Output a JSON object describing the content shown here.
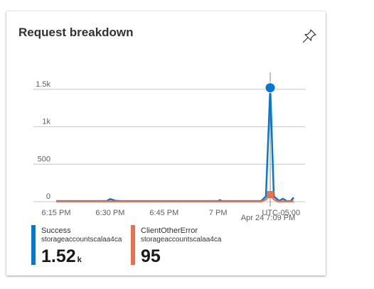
{
  "tile": {
    "title": "Request breakdown",
    "pin_icon": "pin-icon"
  },
  "chart_data": {
    "type": "line",
    "title": "Request breakdown",
    "ylim": [
      0,
      1750
    ],
    "y_ticks": [
      {
        "value": 0,
        "label": "0"
      },
      {
        "value": 500,
        "label": "500"
      },
      {
        "value": 1000,
        "label": "1k"
      },
      {
        "value": 1500,
        "label": "1.5k"
      }
    ],
    "x_ticks": [
      "6:15 PM",
      "6:30 PM",
      "6:45 PM",
      "7 PM",
      "UTC-05:00"
    ],
    "x_range_minutes": [
      0,
      66
    ],
    "x_tick_minutes": [
      0,
      15,
      30,
      45,
      62.5
    ],
    "hover": {
      "x_minute": 59.5,
      "label": "Apr 24 7:09 PM"
    },
    "grid": true,
    "legend_position": "bottom",
    "series": [
      {
        "name": "Success",
        "color": "#0078d4",
        "x": [
          0,
          14,
          15,
          16.5,
          18,
          45,
          45.5,
          46,
          57,
          58.3,
          59.5,
          60.5,
          62,
          63,
          64,
          65.2,
          66
        ],
        "y": [
          8,
          8,
          35,
          12,
          8,
          8,
          22,
          8,
          10,
          70,
          1520,
          70,
          10,
          40,
          10,
          8,
          55
        ],
        "marker": {
          "x": 59.5,
          "y": 1520
        }
      },
      {
        "name": "ClientOtherError",
        "color": "#e8704f",
        "x": [
          0,
          57,
          58.3,
          59.5,
          60.5,
          61.5,
          66
        ],
        "y": [
          3,
          3,
          30,
          95,
          30,
          3,
          3
        ],
        "marker": {
          "x": 59.5,
          "y": 95
        }
      }
    ]
  },
  "legend": [
    {
      "name": "Success",
      "resource": "storageaccountscalaa4ca",
      "value": "1.52",
      "unit": "k",
      "color": "#0078d4"
    },
    {
      "name": "ClientOtherError",
      "resource": "storageaccountscalaa4ca",
      "value": "95",
      "unit": "",
      "color": "#e8704f"
    }
  ]
}
